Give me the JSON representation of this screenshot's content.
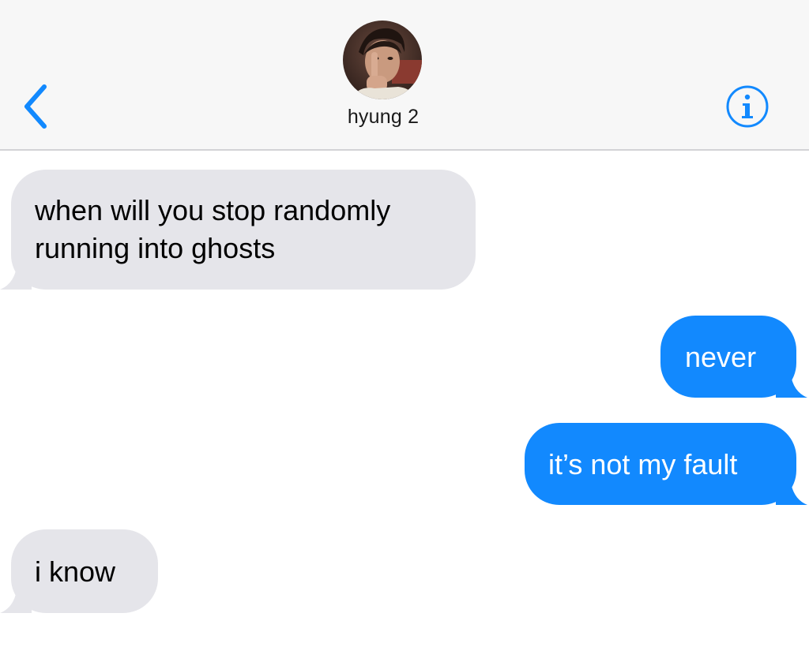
{
  "header": {
    "contact_name": "hyung 2",
    "back_icon": "chevron-left-icon",
    "info_icon": "info-circle-icon",
    "accent_color": "#1289fe"
  },
  "messages": [
    {
      "direction": "received",
      "text_lines": [
        "when will you stop randomly",
        "running into ghosts"
      ]
    },
    {
      "direction": "sent",
      "text": "never"
    },
    {
      "direction": "sent",
      "text": "it’s not my fault"
    },
    {
      "direction": "received",
      "text": "i know"
    }
  ],
  "colors": {
    "received_bubble": "#e5e5ea",
    "sent_bubble": "#1289fe",
    "header_bg": "#f7f7f7"
  }
}
